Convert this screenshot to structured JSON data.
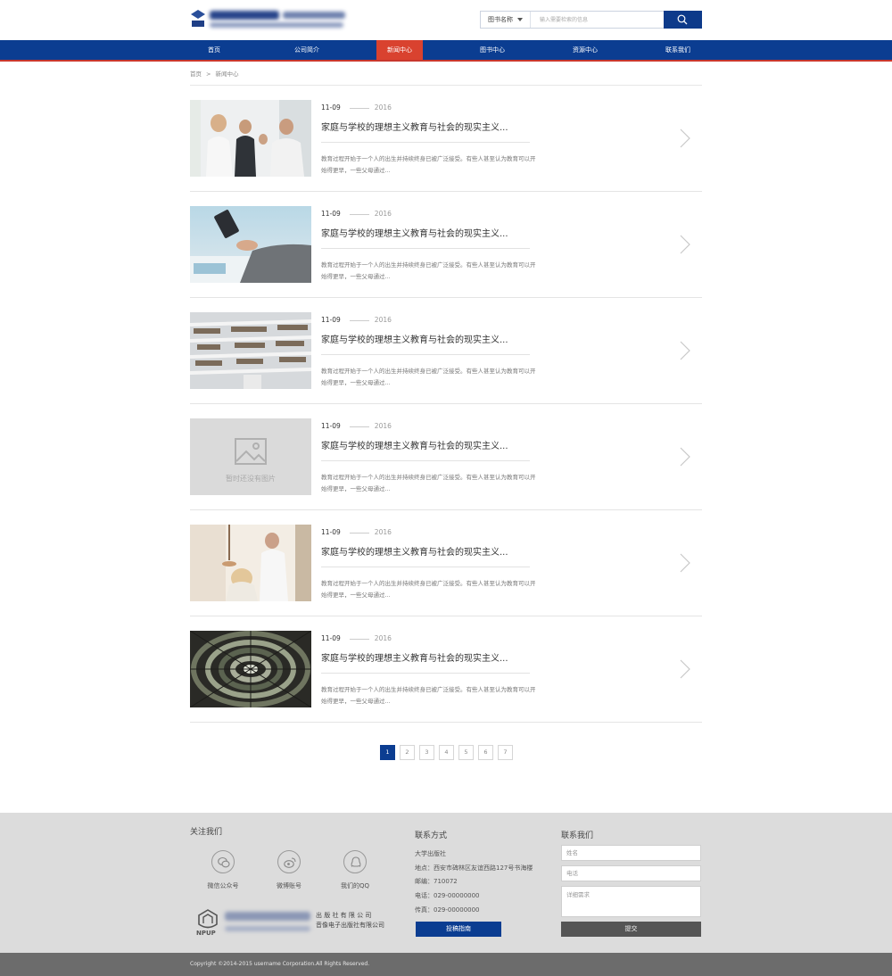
{
  "search": {
    "category": "图书名称",
    "placeholder": "输入需要检索的信息"
  },
  "nav": {
    "items": [
      "首页",
      "公司简介",
      "新闻中心",
      "图书中心",
      "资源中心",
      "联系我们"
    ],
    "active_index": 2
  },
  "breadcrumb": {
    "home": "首页",
    "sep": ">",
    "current": "新闻中心"
  },
  "news": [
    {
      "date": "11-09",
      "year": "2016",
      "title": "家庭与学校的理想主义教育与社会的现实主义...",
      "summary": "教育过程开始于一个人的出生并持续终身已被广泛接受。有些人甚至认为教育可以开始得更早，一些父母通过...",
      "image": "people-meeting-photo"
    },
    {
      "date": "11-09",
      "year": "2016",
      "title": "家庭与学校的理想主义教育与社会的现实主义...",
      "summary": "教育过程开始于一个人的出生并持续终身已被广泛接受。有些人甚至认为教育可以开始得更早，一些父母通过...",
      "image": "tablet-desk-photo"
    },
    {
      "date": "11-09",
      "year": "2016",
      "title": "家庭与学校的理想主义教育与社会的现实主义...",
      "summary": "教育过程开始于一个人的出生并持续终身已被广泛接受。有些人甚至认为教育可以开始得更早，一些父母通过...",
      "image": "library-interior-photo"
    },
    {
      "date": "11-09",
      "year": "2016",
      "title": "家庭与学校的理想主义教育与社会的现实主义...",
      "summary": "教育过程开始于一个人的出生并持续终身已被广泛接受。有些人甚至认为教育可以开始得更早，一些父母通过...",
      "image": "placeholder",
      "placeholder_text": "暂时还没有图片"
    },
    {
      "date": "11-09",
      "year": "2016",
      "title": "家庭与学校的理想主义教育与社会的现实主义...",
      "summary": "教育过程开始于一个人的出生并持续终身已被广泛接受。有些人甚至认为教育可以开始得更早，一些父母通过...",
      "image": "office-people-photo"
    },
    {
      "date": "11-09",
      "year": "2016",
      "title": "家庭与学校的理想主义教育与社会的现实主义...",
      "summary": "教育过程开始于一个人的出生并持续终身已被广泛接受。有些人甚至认为教育可以开始得更早，一些父母通过...",
      "image": "bookshelf-tunnel-photo"
    }
  ],
  "pagination": {
    "pages": [
      "1",
      "2",
      "3",
      "4",
      "5",
      "6",
      "7"
    ],
    "current": "1"
  },
  "footer": {
    "follow_title": "关注我们",
    "social": [
      {
        "label": "微信公众号",
        "icon": "wechat-icon"
      },
      {
        "label": "微博账号",
        "icon": "weibo-icon"
      },
      {
        "label": "我们的QQ",
        "icon": "qq-icon"
      }
    ],
    "logo_text": {
      "line1": "出 版 社 有 限 公 司",
      "line2": "音像电子出版社有限公司",
      "mark": "NPUP"
    },
    "contact_title": "联系方式",
    "contact_lines": [
      "大学出版社",
      "地点：西安市碑林区友谊西路127号书海楼",
      "邮编：710072",
      "电话：029-00000000",
      "传真：029-00000000"
    ],
    "guide_button": "投稿指南",
    "form_title": "联系我们",
    "form": {
      "name_placeholder": "姓名",
      "phone_placeholder": "电话",
      "detail_placeholder": "详细需求",
      "submit": "提交"
    },
    "copyright": "Copyright ©2014-2015 username Corporation.All Rights Reserved."
  },
  "colors": {
    "primary": "#0b3d91",
    "accent": "#d9422f",
    "footer_bg": "#dcdcdc",
    "copyright_bg": "#6c6c6c"
  }
}
